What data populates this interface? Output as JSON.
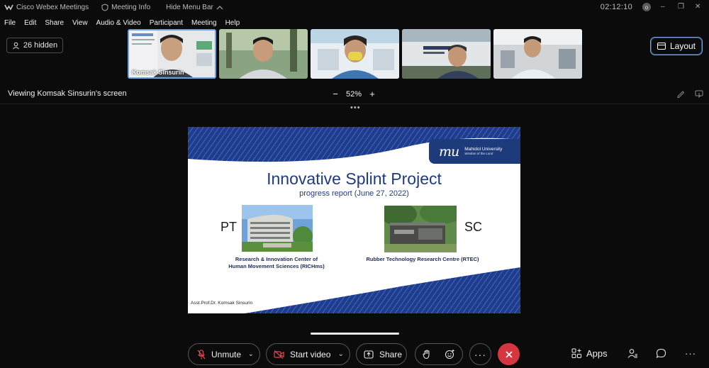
{
  "titlebar": {
    "app_name": "Cisco Webex Meetings",
    "meeting_info": "Meeting Info",
    "hide_menu": "Hide Menu Bar",
    "clock": "02:12:10",
    "badge": "o"
  },
  "menu": [
    "File",
    "Edit",
    "Share",
    "View",
    "Audio & Video",
    "Participant",
    "Meeting",
    "Help"
  ],
  "hidden_chip": "26 hidden",
  "thumbnails": [
    {
      "name": "Komsak Sinsurin",
      "active": true
    },
    {
      "name": "",
      "active": false
    },
    {
      "name": "",
      "active": false
    },
    {
      "name": "",
      "active": false
    },
    {
      "name": "",
      "active": false
    }
  ],
  "layout_button": "Layout",
  "viewing_label": "Viewing Komsak Sinsurin's screen",
  "zoom": {
    "minus": "−",
    "value": "52%",
    "plus": "+"
  },
  "slide": {
    "university": "Mahidol University",
    "tagline": "Wisdom of the Land",
    "logo_text": "mu",
    "title": "Innovative Splint Project",
    "subtitle": "progress report (June 27, 2022)",
    "left_label": "PT",
    "right_label": "SC",
    "left_caption_1": "Research & Innovation Center of",
    "left_caption_2": "Human Movement Sciences (RICHms)",
    "right_caption": "Rubber Technology Research Centre (RTEC)",
    "author": "Asst.Prof.Dr. Komsak Sinsurin"
  },
  "toolbar": {
    "unmute": "Unmute",
    "start_video": "Start video",
    "share": "Share",
    "apps": "Apps"
  },
  "colors": {
    "accent": "#6aa4e0",
    "end_call": "#d6363f",
    "slide_navy": "#1f3a84",
    "badge_navy": "#1d3a7a"
  }
}
